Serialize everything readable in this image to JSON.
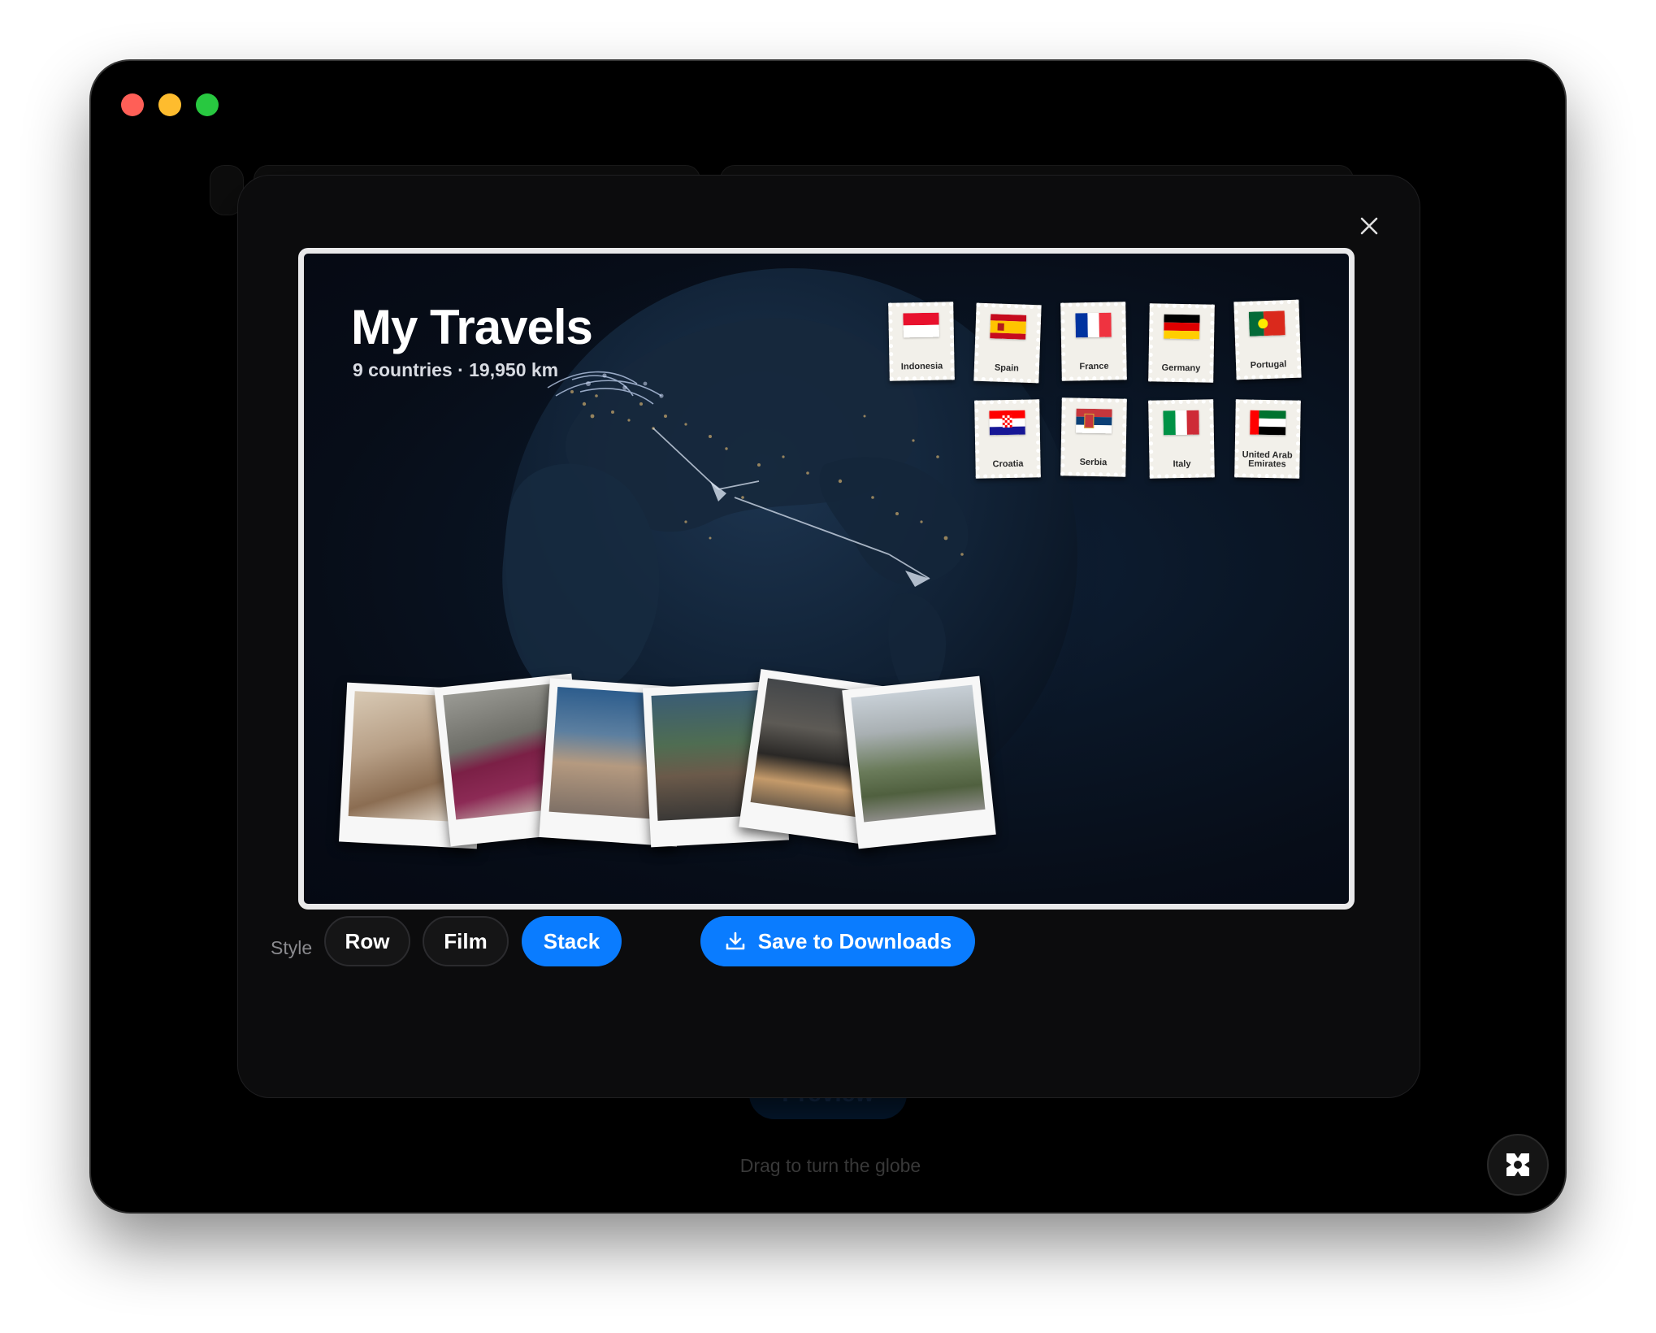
{
  "window": {
    "traffic_lights": [
      "close",
      "minimize",
      "zoom"
    ]
  },
  "background_app": {
    "preview_label": "Preview",
    "hint": "Drag to turn the globe",
    "corner_icon": "app-logo-icon"
  },
  "modal": {
    "close_icon": "close-icon",
    "card": {
      "title": "My Travels",
      "subtitle": "9 countries · 19,950 km",
      "stamps": [
        {
          "label": "Indonesia"
        },
        {
          "label": "Spain"
        },
        {
          "label": "France"
        },
        {
          "label": "Germany"
        },
        {
          "label": "Portugal"
        },
        {
          "label": "Croatia"
        },
        {
          "label": "Serbia"
        },
        {
          "label": "Italy"
        },
        {
          "label": "United Arab Emirates"
        }
      ],
      "photos_count": 6
    },
    "controls": {
      "style_label": "Style",
      "styles": [
        "Row",
        "Film",
        "Stack"
      ],
      "selected_style": "Stack",
      "save_label": "Save to Downloads",
      "save_icon": "download-icon"
    },
    "colors": {
      "accent": "#0a7cff",
      "modal_bg": "#0c0c0d"
    }
  }
}
